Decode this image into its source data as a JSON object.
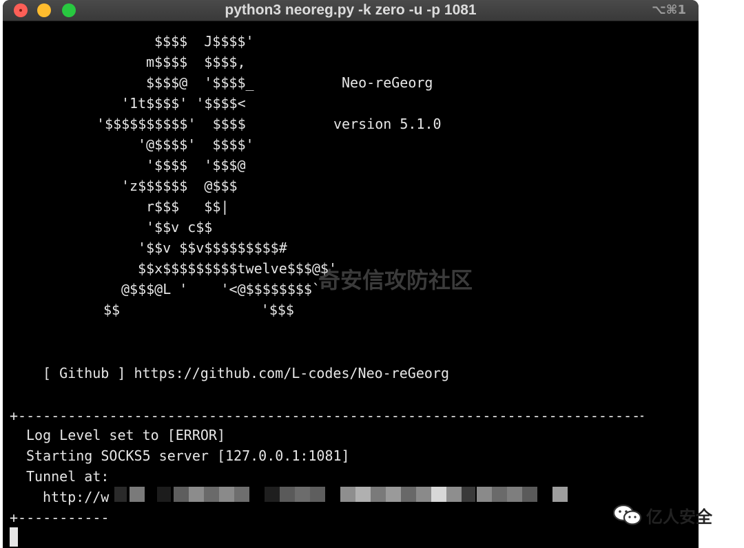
{
  "window": {
    "title": "python3 neoreg.py -k zero -u  -p 1081",
    "shortcut": "⌥⌘1"
  },
  "banner": {
    "art_lines": [
      "$$$$  J$$$$'",
      "m$$$$  $$$$,",
      "$$$$@  '$$$$_",
      "'1t$$$$' '$$$$<",
      "'$$$$$$$$$$'  $$$$",
      "'@$$$$'  $$$$'",
      "'$$$$  '$$$@",
      "'z$$$$$$  @$$$",
      "r$$$   $$|",
      "'$$v c$$",
      "'$$v $$v$$$$$$$$$#",
      "$$x$$$$$$$$$twelve$$$@$'",
      "@$$$@L '    '<@$$$$$$$$`",
      "$$                 '$$$"
    ],
    "name": "Neo-reGeorg",
    "version": "version 5.1.0",
    "github_line": "[ Github ] https://github.com/L-codes/Neo-reGeorg"
  },
  "log": {
    "separator": "+---------------------------------------------------------------------------+",
    "lines": [
      "Log Level set to [ERROR]",
      "Starting SOCKS5 server [127.0.0.1:1081]",
      "Tunnel at:"
    ],
    "tunnel_url_prefix": "http://w",
    "bottom_separator": "+-----------"
  },
  "watermark": "奇安信攻防社区",
  "brand": {
    "name": "亿人安全",
    "icon": "wechat-icon"
  }
}
